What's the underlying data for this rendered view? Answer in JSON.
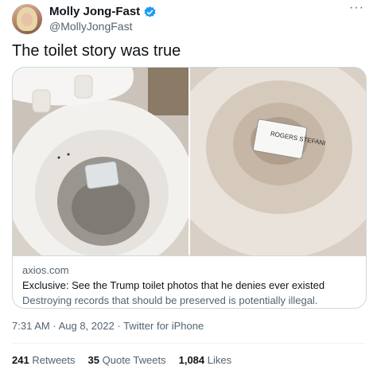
{
  "author": {
    "name": "Molly Jong-Fast",
    "handle": "@MollyJongFast",
    "verified": true
  },
  "menu_icon": "more-icon",
  "tweet": {
    "text": "The toilet story was true"
  },
  "card": {
    "domain": "axios.com",
    "title": "Exclusive: See the Trump toilet photos that he denies ever existed",
    "description": "Destroying records that should be preserved is potentially illegal.",
    "photo_note_text": "ROGERS STEFANI"
  },
  "meta": {
    "time": "7:31 AM",
    "separator1": "·",
    "date": "Aug 8, 2022",
    "separator2": "·",
    "source": "Twitter for iPhone"
  },
  "stats": {
    "retweets_count": "241",
    "retweets_label": "Retweets",
    "quotes_count": "35",
    "quotes_label": "Quote Tweets",
    "likes_count": "1,084",
    "likes_label": "Likes"
  },
  "colors": {
    "verified": "#1d9bf0",
    "text_primary": "#0f1419",
    "text_secondary": "#536471",
    "border": "#cfd9de"
  }
}
